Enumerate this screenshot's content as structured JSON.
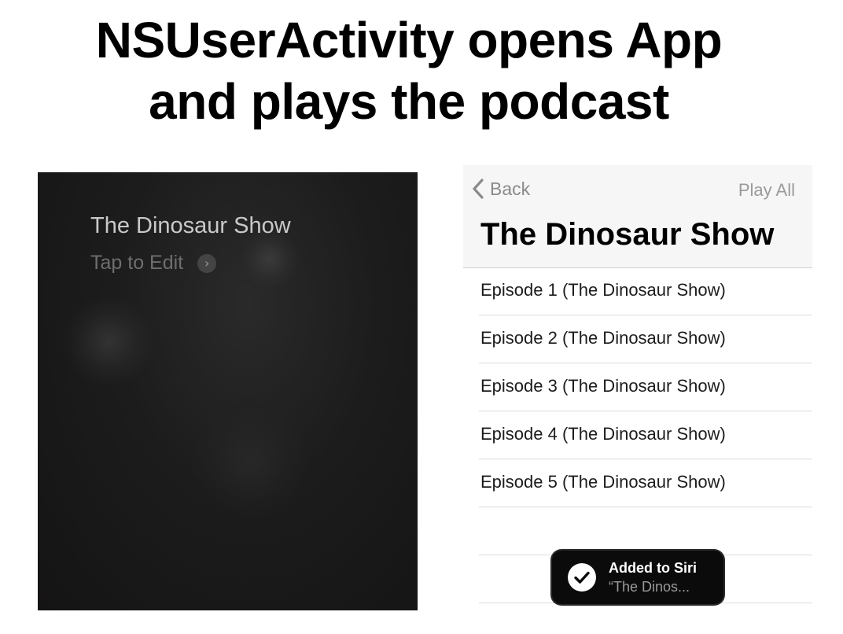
{
  "slide": {
    "title_line1": "NSUserActivity opens App",
    "title_line2": "and plays the podcast"
  },
  "siri": {
    "shortcut_name": "The Dinosaur Show",
    "edit_label": "Tap to Edit",
    "edit_icon": "chevron-right-icon",
    "chevron_glyph": "›"
  },
  "app": {
    "nav": {
      "back_label": "Back",
      "back_icon": "chevron-left-icon",
      "play_all_label": "Play All"
    },
    "title": "The Dinosaur Show",
    "episodes": [
      "Episode 1 (The Dinosaur Show)",
      "Episode 2 (The Dinosaur Show)",
      "Episode 3 (The Dinosaur Show)",
      "Episode 4 (The Dinosaur Show)",
      "Episode 5 (The Dinosaur Show)"
    ],
    "toast": {
      "icon": "checkmark-icon",
      "title": "Added to Siri",
      "subtitle": "“The Dinos..."
    }
  },
  "colors": {
    "siri_background": "#1c1c1c",
    "nav_background": "#f6f6f6",
    "toast_background": "#0b0b0b",
    "secondary_text": "#8a8a8a"
  }
}
